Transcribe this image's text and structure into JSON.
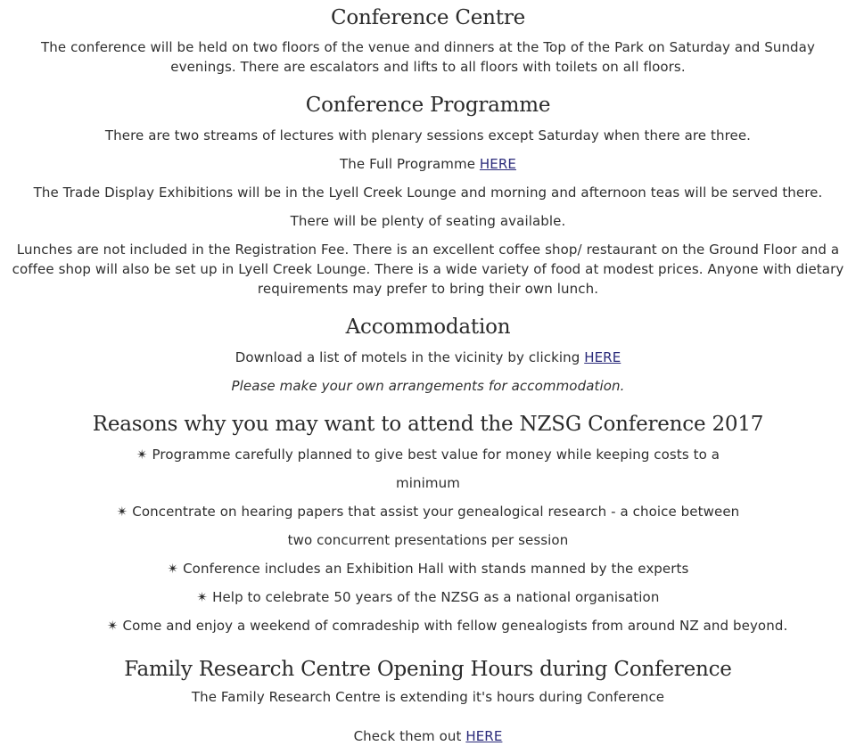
{
  "venue": {
    "title": "Conference Centre",
    "body": "The conference will be held on two floors of the venue and dinners at the Top of the Park on Saturday and Sunday evenings. There are escalators and lifts to all floors with toilets on all floors."
  },
  "programme": {
    "title": "Conference Programme",
    "streams": "There are two streams of lectures with plenary sessions except Saturday when there are three.",
    "full_programme_text": "The Full Programme ",
    "full_programme_link": "HERE",
    "trade_display": "The Trade Display Exhibitions will be in the Lyell Creek Lounge and morning and afternoon teas will be served there.",
    "seating": "There will be plenty of seating available.",
    "lunches": "Lunches are not included in the Registration Fee. There is an excellent coffee shop/ restaurant on the Ground Floor and a coffee shop will also be set up in Lyell Creek Lounge.  There is a wide variety of food at modest prices.  Anyone with dietary requirements may prefer to bring their own lunch."
  },
  "accommodation": {
    "title": "Accommodation",
    "download_text": "Download a list of motels in the vicinity by clicking ",
    "download_link": "HERE",
    "note": "Please make your own arrangements for accommodation."
  },
  "reasons": {
    "title": "Reasons why you may want to attend the NZSG Conference 2017",
    "bullet_symbol": "✴",
    "items": [
      "Programme carefully planned to give best value for money while keeping costs to a minimum",
      "Concentrate on hearing papers that assist your genealogical research - a choice between two concurrent presentations per session",
      "Conference includes an Exhibition Hall with stands manned by the experts",
      "Help to celebrate 50 years of the NZSG as a national organisation",
      "Come and enjoy a weekend of comradeship with fellow genealogists from around NZ and beyond."
    ]
  },
  "research_centre": {
    "title": "Family Research Centre Opening Hours during Conference",
    "body": "The Family Research Centre is extending it's hours during Conference",
    "check_text": "Check them out ",
    "check_link": "HERE"
  },
  "colors": {
    "text": "#2e2e2e",
    "heading": "#2a2a2a",
    "link": "#2a2a7a",
    "background": "#ffffff"
  }
}
